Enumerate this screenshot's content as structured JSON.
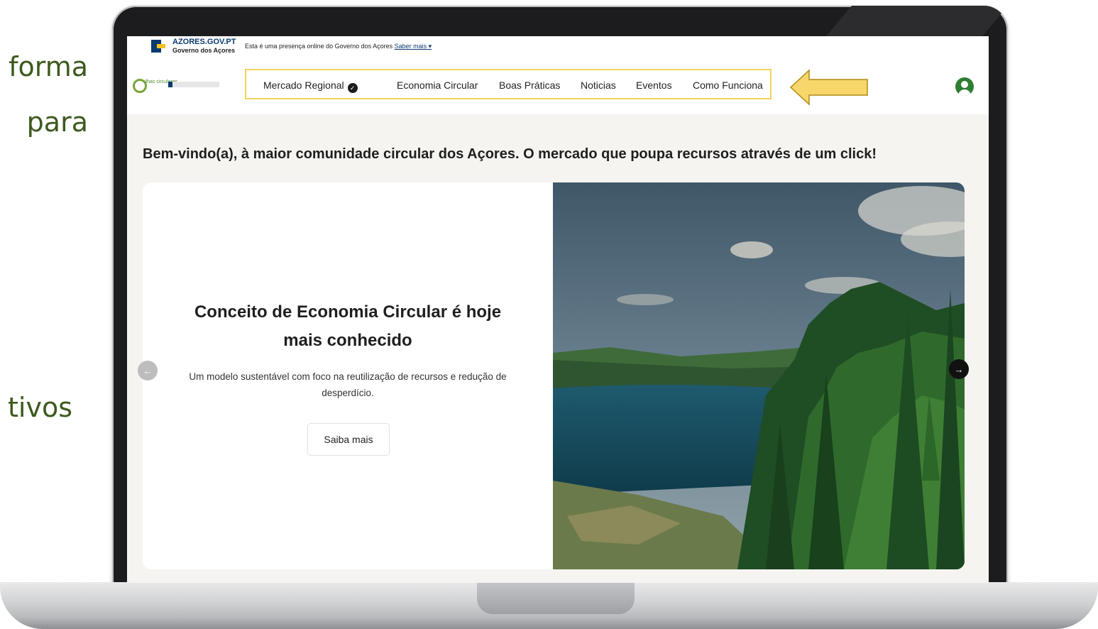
{
  "side_text": {
    "line1": "forma",
    "line2": "para",
    "line3": "tivos"
  },
  "gov_bar": {
    "name": "AZORES.GOV.PT",
    "subtitle": "Governo dos Açores",
    "notice": "Esta é uma presença online do Governo dos Açores",
    "more_link": "Saber mais ▾"
  },
  "logo": {
    "text": "ilhas circulares"
  },
  "nav": {
    "items": [
      "Mercado Regional",
      "Economia Circular",
      "Boas Práticas",
      "Noticias",
      "Eventos",
      "Como Funciona"
    ],
    "check_icon": "check-circle-icon"
  },
  "welcome": "Bem-vindo(a), à maior comunidade circular dos Açores. O mercado que poupa recursos através de um click!",
  "hero": {
    "title": "Conceito de Economia Circular é hoje mais conhecido",
    "description": "Um modelo sustentável com foco na reutilização de recursos e redução de desperdício.",
    "button": "Saiba mais",
    "prev_arrow": "←",
    "next_arrow": "→"
  },
  "colors": {
    "accent_green": "#2e7d32",
    "nav_highlight": "#f4d35e",
    "arrow_fill": "#f7d66b"
  }
}
